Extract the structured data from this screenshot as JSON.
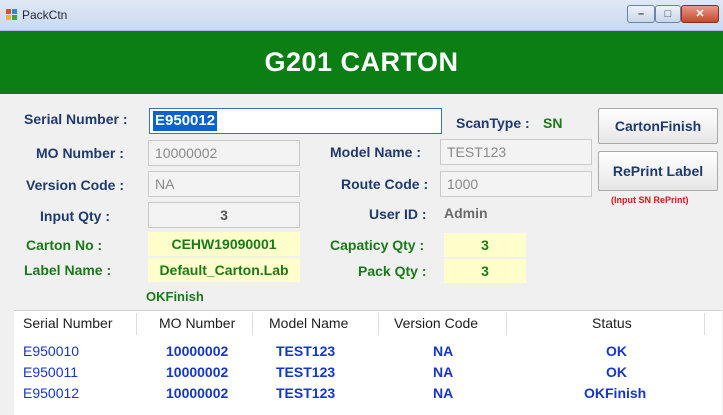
{
  "window": {
    "title": "PackCtn",
    "min_glyph": "–",
    "max_glyph": "□",
    "close_glyph": "✕"
  },
  "banner": {
    "title": "G201 CARTON"
  },
  "form": {
    "serial_label": "Serial Number :",
    "serial_value": "E950012",
    "scantype_label": "ScanType :",
    "scantype_value": "SN",
    "mo_label": "MO Number :",
    "mo_value": "10000002",
    "model_label": "Model Name :",
    "model_value": "TEST123",
    "version_label": "Version Code :",
    "version_value": "NA",
    "route_label": "Route Code :",
    "route_value": "1000",
    "inputqty_label": "Input Qty :",
    "inputqty_value": "3",
    "userid_label": "User ID :",
    "userid_value": "Admin",
    "carton_label": "Carton No :",
    "carton_value": "CEHW19090001",
    "capacity_label": "Capaticy Qty :",
    "capacity_value": "3",
    "labelname_label": "Label Name :",
    "labelname_value": "Default_Carton.Lab",
    "packqty_label": "Pack Qty :",
    "packqty_value": "3",
    "status_message": "OKFinish"
  },
  "buttons": {
    "carton_finish": "CartonFinish",
    "reprint_label": "RePrint Label",
    "reprint_note": "(Input SN RePrint)"
  },
  "grid": {
    "columns": [
      "Serial Number",
      "MO Number",
      "Model Name",
      "Version Code",
      "Status"
    ],
    "rows": [
      [
        "E950010",
        "10000002",
        "TEST123",
        "NA",
        "OK"
      ],
      [
        "E950011",
        "10000002",
        "TEST123",
        "NA",
        "OK"
      ],
      [
        "E950012",
        "10000002",
        "TEST123",
        "NA",
        "OKFinish"
      ]
    ]
  },
  "colors": {
    "banner": "#0b7f14",
    "label_blue": "#1f3a6e",
    "label_green": "#1a7a17",
    "grid_text": "#1636c8",
    "highlight": "#ffffcc"
  }
}
